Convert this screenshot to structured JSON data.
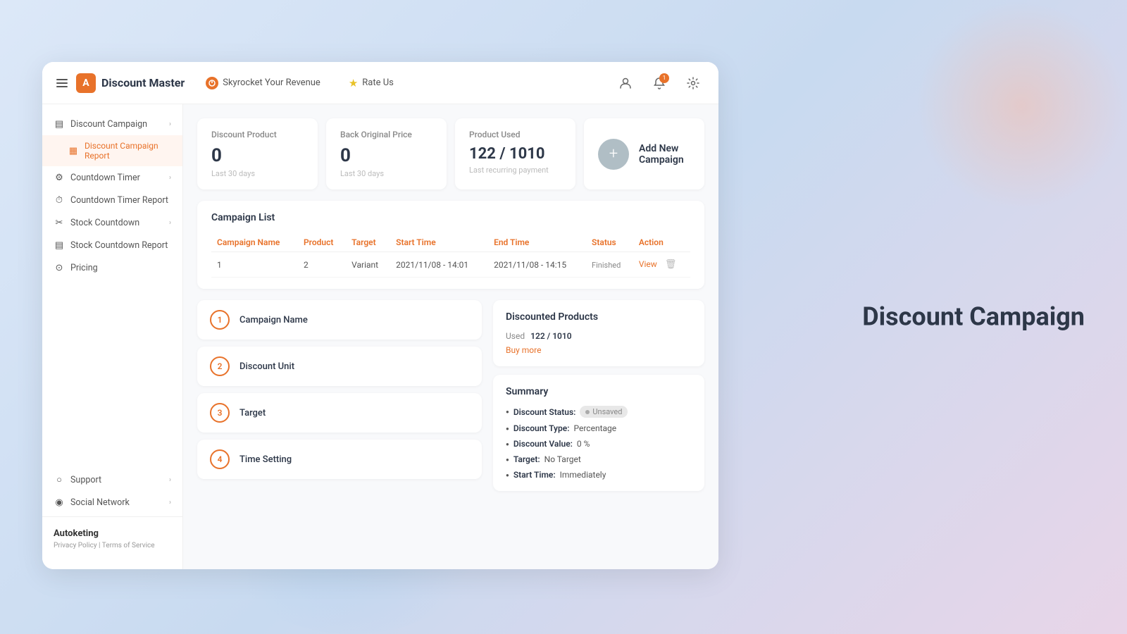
{
  "background": {
    "title_right": "Discount Campaign"
  },
  "navbar": {
    "hamburger_label": "menu",
    "logo_letter": "A",
    "app_name": "Discount Master",
    "nav1_label": "Skyrocket Your Revenue",
    "nav2_label": "Rate Us",
    "notification_count": "1",
    "icons": {
      "user": "👤",
      "bell": "🔔",
      "settings": "⚙"
    }
  },
  "sidebar": {
    "items": [
      {
        "id": "discount-campaign",
        "label": "Discount Campaign",
        "icon": "▤",
        "has_chevron": true,
        "active": false
      },
      {
        "id": "discount-campaign-report",
        "label": "Discount Campaign Report",
        "icon": "▦",
        "has_chevron": false,
        "active": true
      },
      {
        "id": "countdown-timer",
        "label": "Countdown Timer",
        "icon": "⚙",
        "has_chevron": true,
        "active": false
      },
      {
        "id": "countdown-timer-report",
        "label": "Countdown Timer Report",
        "icon": "⏱",
        "has_chevron": false,
        "active": false
      },
      {
        "id": "stock-countdown",
        "label": "Stock Countdown",
        "icon": "✂",
        "has_chevron": true,
        "active": false
      },
      {
        "id": "stock-countdown-report",
        "label": "Stock Countdown Report",
        "icon": "▤",
        "has_chevron": false,
        "active": false
      },
      {
        "id": "pricing",
        "label": "Pricing",
        "icon": "⊙",
        "has_chevron": false,
        "active": false
      }
    ],
    "bottom_items": [
      {
        "id": "support",
        "label": "Support",
        "icon": "○",
        "has_chevron": true
      },
      {
        "id": "social-network",
        "label": "Social Network",
        "icon": "◉",
        "has_chevron": true
      }
    ],
    "brand": "Autoketing",
    "privacy_link": "Privacy Policy",
    "separator": "|",
    "terms_link": "Terms of Service"
  },
  "stats": [
    {
      "id": "discount-product",
      "label": "Discount Product",
      "value": "0",
      "sublabel": "Last 30 days"
    },
    {
      "id": "back-original-price",
      "label": "Back Original Price",
      "value": "0",
      "sublabel": "Last 30 days"
    },
    {
      "id": "product-used",
      "label": "Product Used",
      "value": "122 / 1010",
      "sublabel": "Last recurring payment"
    }
  ],
  "add_campaign": {
    "icon": "+",
    "label": "Add New Campaign"
  },
  "campaign_list": {
    "section_title": "Campaign List",
    "columns": [
      "Campaign Name",
      "Product",
      "Target",
      "Start Time",
      "End Time",
      "Status",
      "Action"
    ],
    "rows": [
      {
        "name": "1",
        "product": "2",
        "target": "Variant",
        "start_time": "2021/11/08 - 14:01",
        "end_time": "2021/11/08 - 14:15",
        "status": "Finished",
        "action_view": "View"
      }
    ]
  },
  "form_steps": [
    {
      "number": "1",
      "label": "Campaign Name"
    },
    {
      "number": "2",
      "label": "Discount Unit"
    },
    {
      "number": "3",
      "label": "Target"
    },
    {
      "number": "4",
      "label": "Time Setting"
    }
  ],
  "right_panels": {
    "discounted_products": {
      "title": "Discounted Products",
      "used_label": "Used",
      "used_value": "122 / 1010",
      "buy_more": "Buy more"
    },
    "summary": {
      "title": "Summary",
      "items": [
        {
          "key": "Discount Status:",
          "value": "",
          "badge": "Unsaved"
        },
        {
          "key": "Discount Type:",
          "value": "Percentage"
        },
        {
          "key": "Discount Value:",
          "value": "0 %"
        },
        {
          "key": "Target:",
          "value": "No Target"
        },
        {
          "key": "Start Time:",
          "value": "Immediately"
        }
      ]
    }
  }
}
